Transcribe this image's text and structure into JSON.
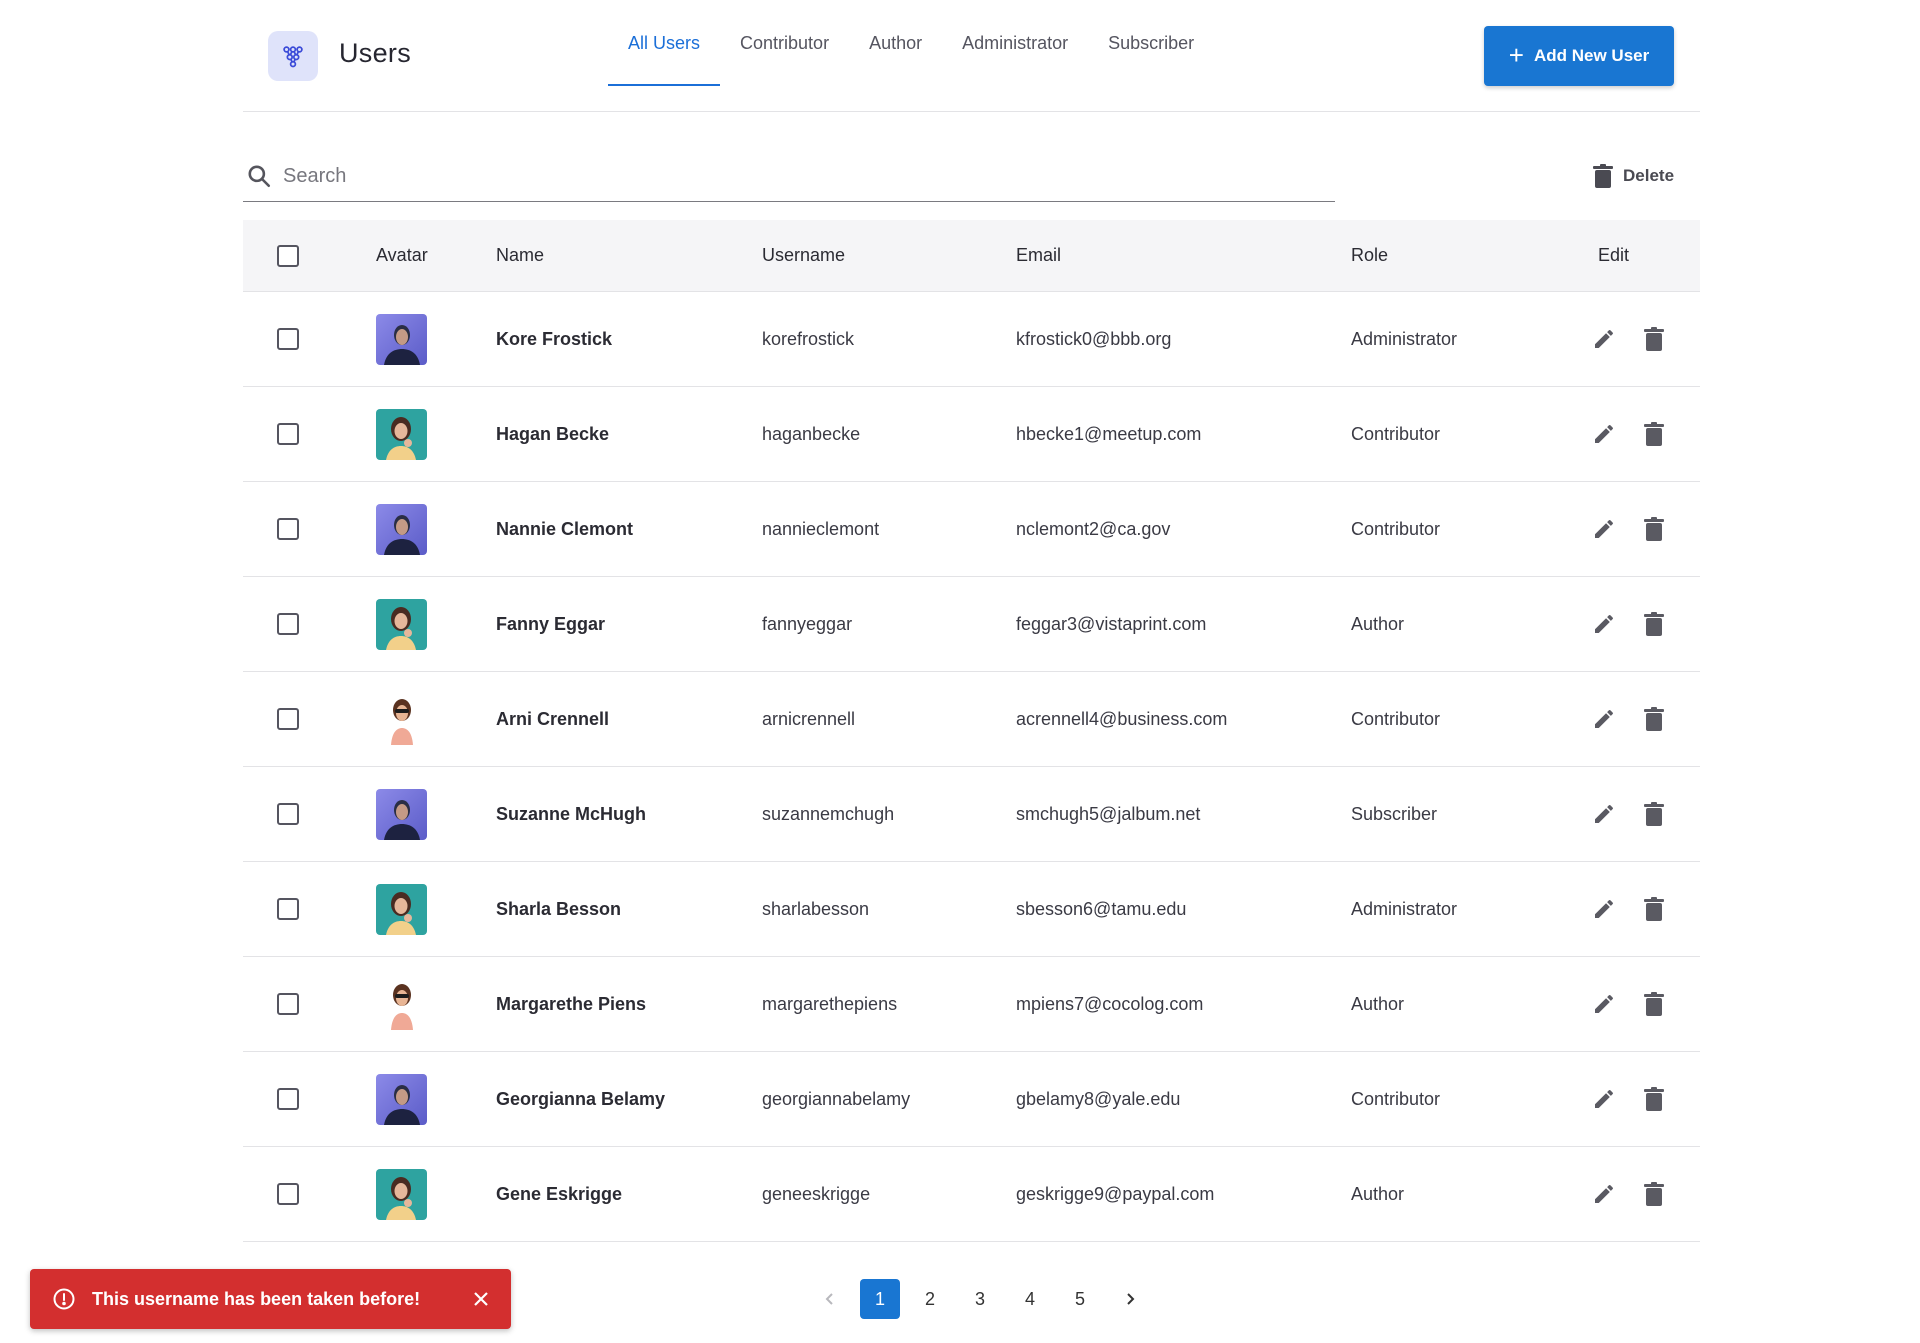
{
  "header": {
    "title": "Users",
    "tabs": [
      {
        "label": "All Users",
        "active": true
      },
      {
        "label": "Contributor",
        "active": false
      },
      {
        "label": "Author",
        "active": false
      },
      {
        "label": "Administrator",
        "active": false
      },
      {
        "label": "Subscriber",
        "active": false
      }
    ],
    "add_button_label": "Add New User",
    "logo_icon": "users-network-icon"
  },
  "toolbar": {
    "search_placeholder": "Search",
    "search_value": "",
    "delete_label": "Delete"
  },
  "table": {
    "columns": [
      "Avatar",
      "Name",
      "Username",
      "Email",
      "Role",
      "Edit"
    ],
    "rows": [
      {
        "avatar": "avatar-purple",
        "name": "Kore Frostick",
        "username": "korefrostick",
        "email": "kfrostick0@bbb.org",
        "role": "Administrator"
      },
      {
        "avatar": "avatar-teal",
        "name": "Hagan Becke",
        "username": "haganbecke",
        "email": "hbecke1@meetup.com",
        "role": "Contributor"
      },
      {
        "avatar": "avatar-purple",
        "name": "Nannie Clemont",
        "username": "nannieclemont",
        "email": "nclemont2@ca.gov",
        "role": "Contributor"
      },
      {
        "avatar": "avatar-teal",
        "name": "Fanny Eggar",
        "username": "fannyeggar",
        "email": "feggar3@vistaprint.com",
        "role": "Author"
      },
      {
        "avatar": "avatar-white",
        "name": "Arni Crennell",
        "username": "arnicrennell",
        "email": "acrennell4@business.com",
        "role": "Contributor"
      },
      {
        "avatar": "avatar-purple",
        "name": "Suzanne McHugh",
        "username": "suzannemchugh",
        "email": "smchugh5@jalbum.net",
        "role": "Subscriber"
      },
      {
        "avatar": "avatar-teal",
        "name": "Sharla Besson",
        "username": "sharlabesson",
        "email": "sbesson6@tamu.edu",
        "role": "Administrator"
      },
      {
        "avatar": "avatar-white",
        "name": "Margarethe Piens",
        "username": "margarethepiens",
        "email": "mpiens7@cocolog.com",
        "role": "Author"
      },
      {
        "avatar": "avatar-purple",
        "name": "Georgianna Belamy",
        "username": "georgiannabelamy",
        "email": "gbelamy8@yale.edu",
        "role": "Contributor"
      },
      {
        "avatar": "avatar-teal",
        "name": "Gene Eskrigge",
        "username": "geneeskrigge",
        "email": "geskrigge9@paypal.com",
        "role": "Author"
      }
    ]
  },
  "pagination": {
    "pages": [
      "1",
      "2",
      "3",
      "4",
      "5"
    ],
    "current": "1"
  },
  "toast": {
    "message": "This username has been taken before!",
    "color": "#d32f2f"
  },
  "colors": {
    "accent": "#1976d2",
    "error": "#d32f2f",
    "header_bg": "#f5f5f7"
  }
}
